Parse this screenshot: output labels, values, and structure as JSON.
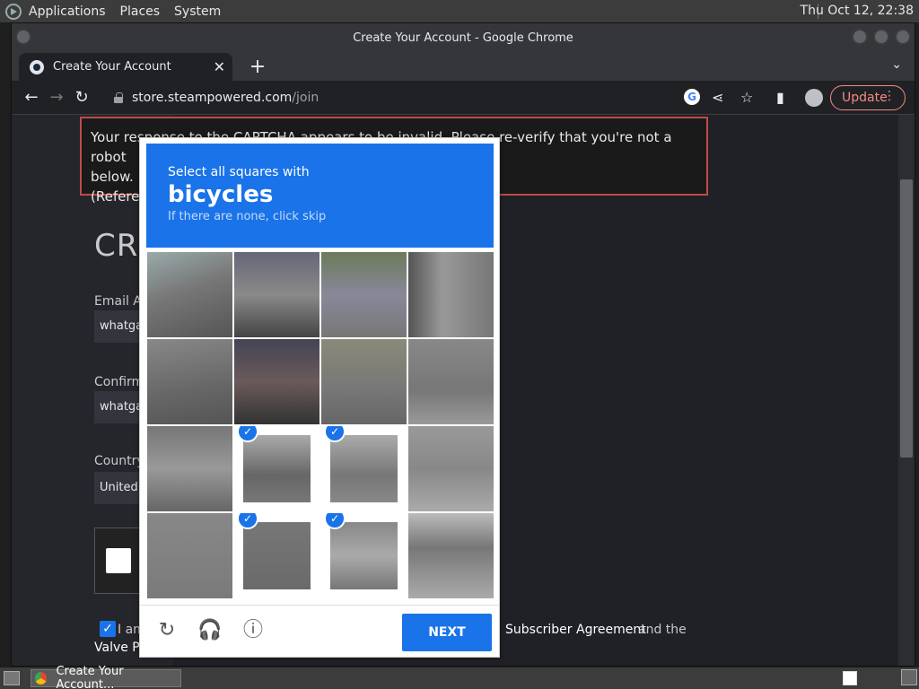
{
  "top_panel": {
    "menus": [
      "Applications",
      "Places",
      "System"
    ],
    "clock": "Thu Oct 12, 22:38"
  },
  "window": {
    "title": "Create Your Account - Google Chrome"
  },
  "tab": {
    "title": "Create Your Account",
    "close": "✕",
    "new_tab": "+"
  },
  "toolbar": {
    "url_host": "store.steampowered.com",
    "url_path": "/join",
    "update_label": "Update",
    "more": "⋮",
    "google_letter": "G"
  },
  "page": {
    "error_line1": "Your response to the CAPTCHA appears to be invalid. Please re-verify that you're not a robot",
    "error_line2": "below.",
    "error_line3": "(Referen",
    "title": "CRE",
    "email_label": "Email Ac",
    "email_value": "whatga",
    "confirm_label": "Confirm",
    "confirm_value": "whatga",
    "country_label": "Country",
    "country_value": "United",
    "agree_text": "I am",
    "agree_link_1": "Subscriber Agreement",
    "agree_and": "and the",
    "agree_link_2": "Valve Pr"
  },
  "captcha": {
    "instruction": "Select all squares with",
    "target": "bicycles",
    "hint": "If there are none, click skip",
    "next_label": "NEXT",
    "tiles": [
      {
        "selected": false
      },
      {
        "selected": false
      },
      {
        "selected": false
      },
      {
        "selected": false
      },
      {
        "selected": false
      },
      {
        "selected": false
      },
      {
        "selected": false
      },
      {
        "selected": false
      },
      {
        "selected": false
      },
      {
        "selected": true
      },
      {
        "selected": true
      },
      {
        "selected": false
      },
      {
        "selected": false
      },
      {
        "selected": true
      },
      {
        "selected": true
      },
      {
        "selected": false
      }
    ],
    "colors": {
      "header": "#1a73e8",
      "check": "#1a73e8"
    }
  },
  "taskbar": {
    "item_label": "Create Your Account..."
  }
}
